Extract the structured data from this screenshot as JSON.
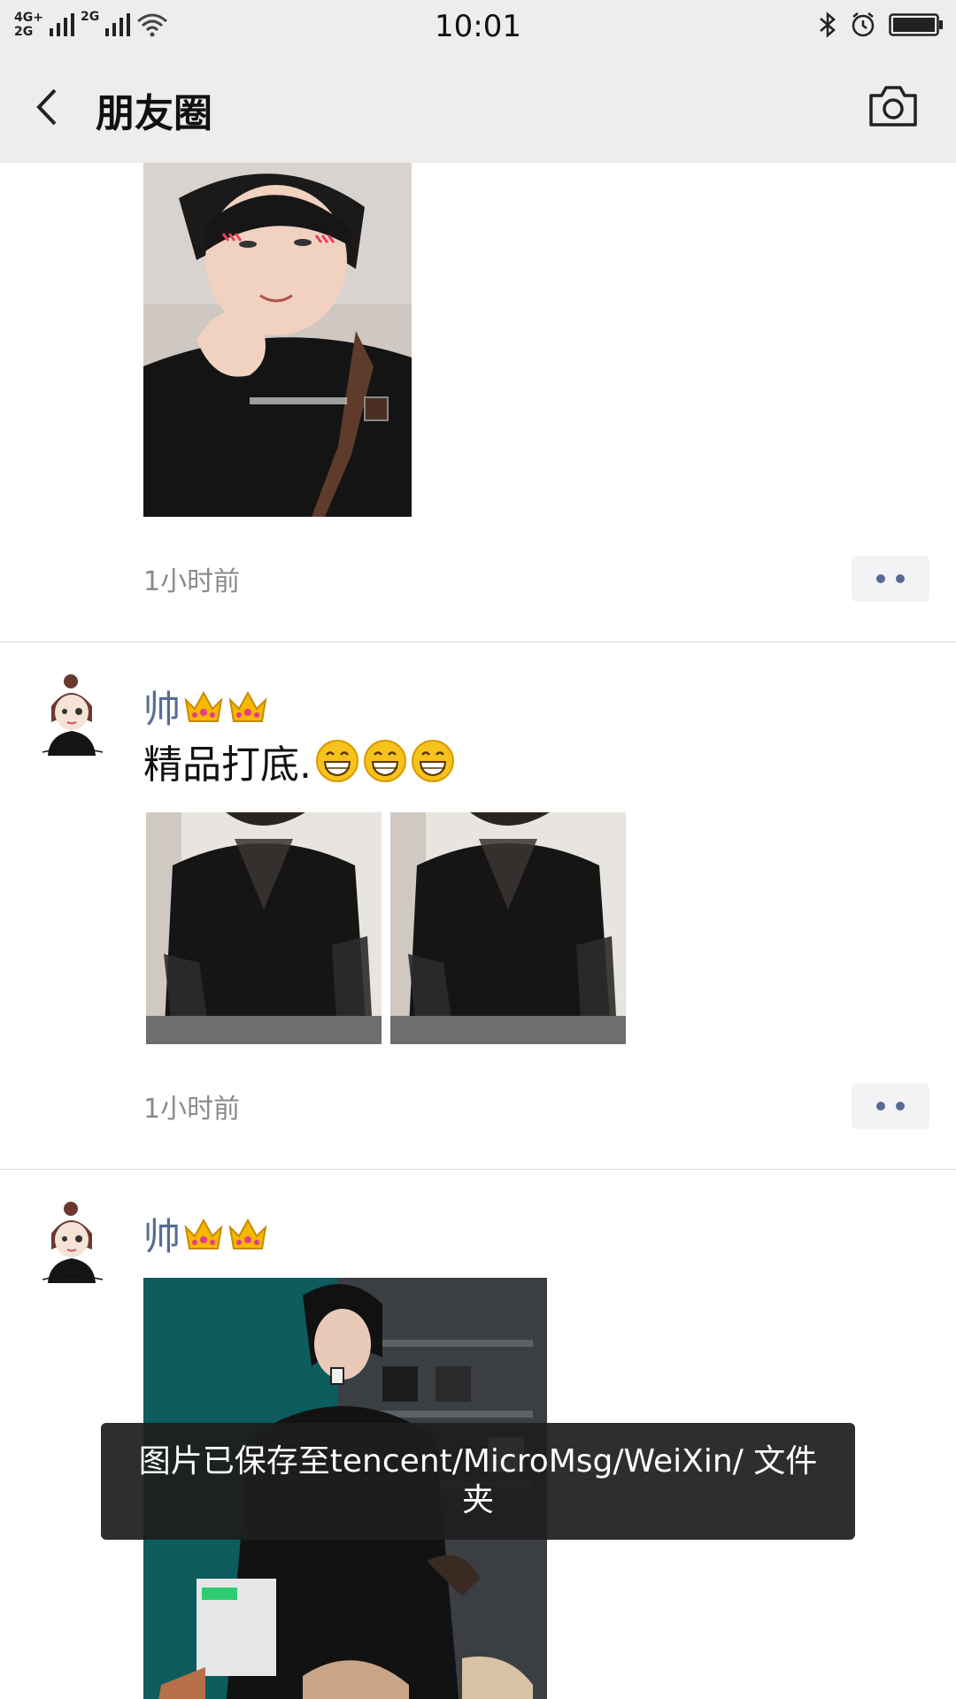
{
  "status_bar": {
    "network_top": "4G+",
    "network_bottom": "2G",
    "network2": "2G",
    "time": "10:01"
  },
  "nav": {
    "title": "朋友圈"
  },
  "posts": [
    {
      "time": "1小时前"
    },
    {
      "username": "帅",
      "text": "精品打底.",
      "time": "1小时前"
    },
    {
      "username": "帅"
    }
  ],
  "toast": {
    "message": "图片已保存至tencent/MicroMsg/WeiXin/ 文件夹"
  },
  "icons": {
    "back": "chevron-left-icon",
    "camera": "camera-icon",
    "bluetooth": "bluetooth-icon",
    "alarm": "alarm-icon",
    "battery": "battery-icon",
    "wifi": "wifi-icon",
    "signal": "signal-icon",
    "crown": "crown-emoji",
    "grin": "grin-emoji",
    "more": "more-dots-icon"
  },
  "colors": {
    "username": "#576b95",
    "nav_bg": "#ededed",
    "time_text": "#8a8a8a",
    "toast_bg": "#1e1e1e"
  }
}
